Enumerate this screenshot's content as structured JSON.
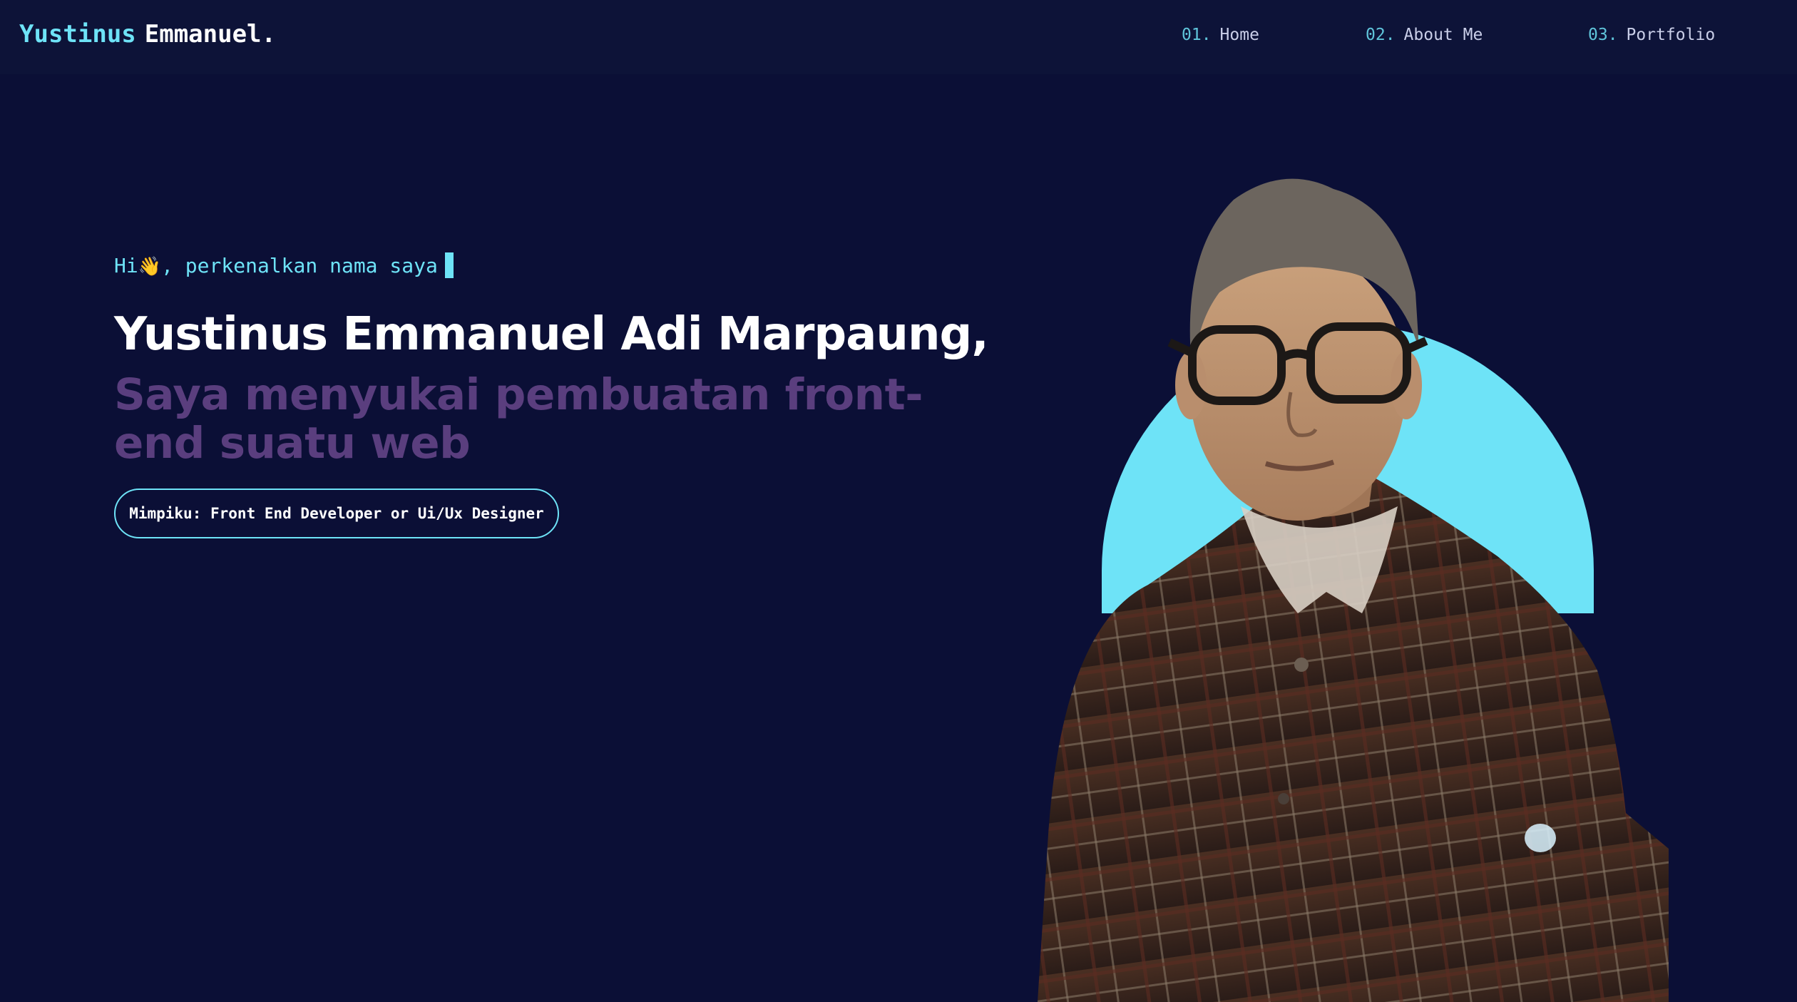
{
  "logo": {
    "first": "Yustinus",
    "last": "Emmanuel."
  },
  "nav": [
    {
      "num": "01.",
      "label": "Home"
    },
    {
      "num": "02.",
      "label": "About Me"
    },
    {
      "num": "03.",
      "label": "Portfolio"
    }
  ],
  "hero": {
    "greeting_prefix": "Hi",
    "greeting_emoji": "👋",
    "greeting_suffix": ", perkenalkan nama saya",
    "name": "Yustinus Emmanuel Adi Marpaung,",
    "tagline": "Saya menyukai pembuatan front-end suatu web",
    "dream": "Mimpiku: Front End Developer or Ui/Ux Designer"
  },
  "colors": {
    "background": "#0b0f36",
    "navbar": "#0d1338",
    "accent_cyan": "#6ee3f7",
    "tagline_purple": "#5a3e7e",
    "text_white": "#ffffff"
  },
  "icons": {
    "wave": "waving-hand-icon"
  }
}
